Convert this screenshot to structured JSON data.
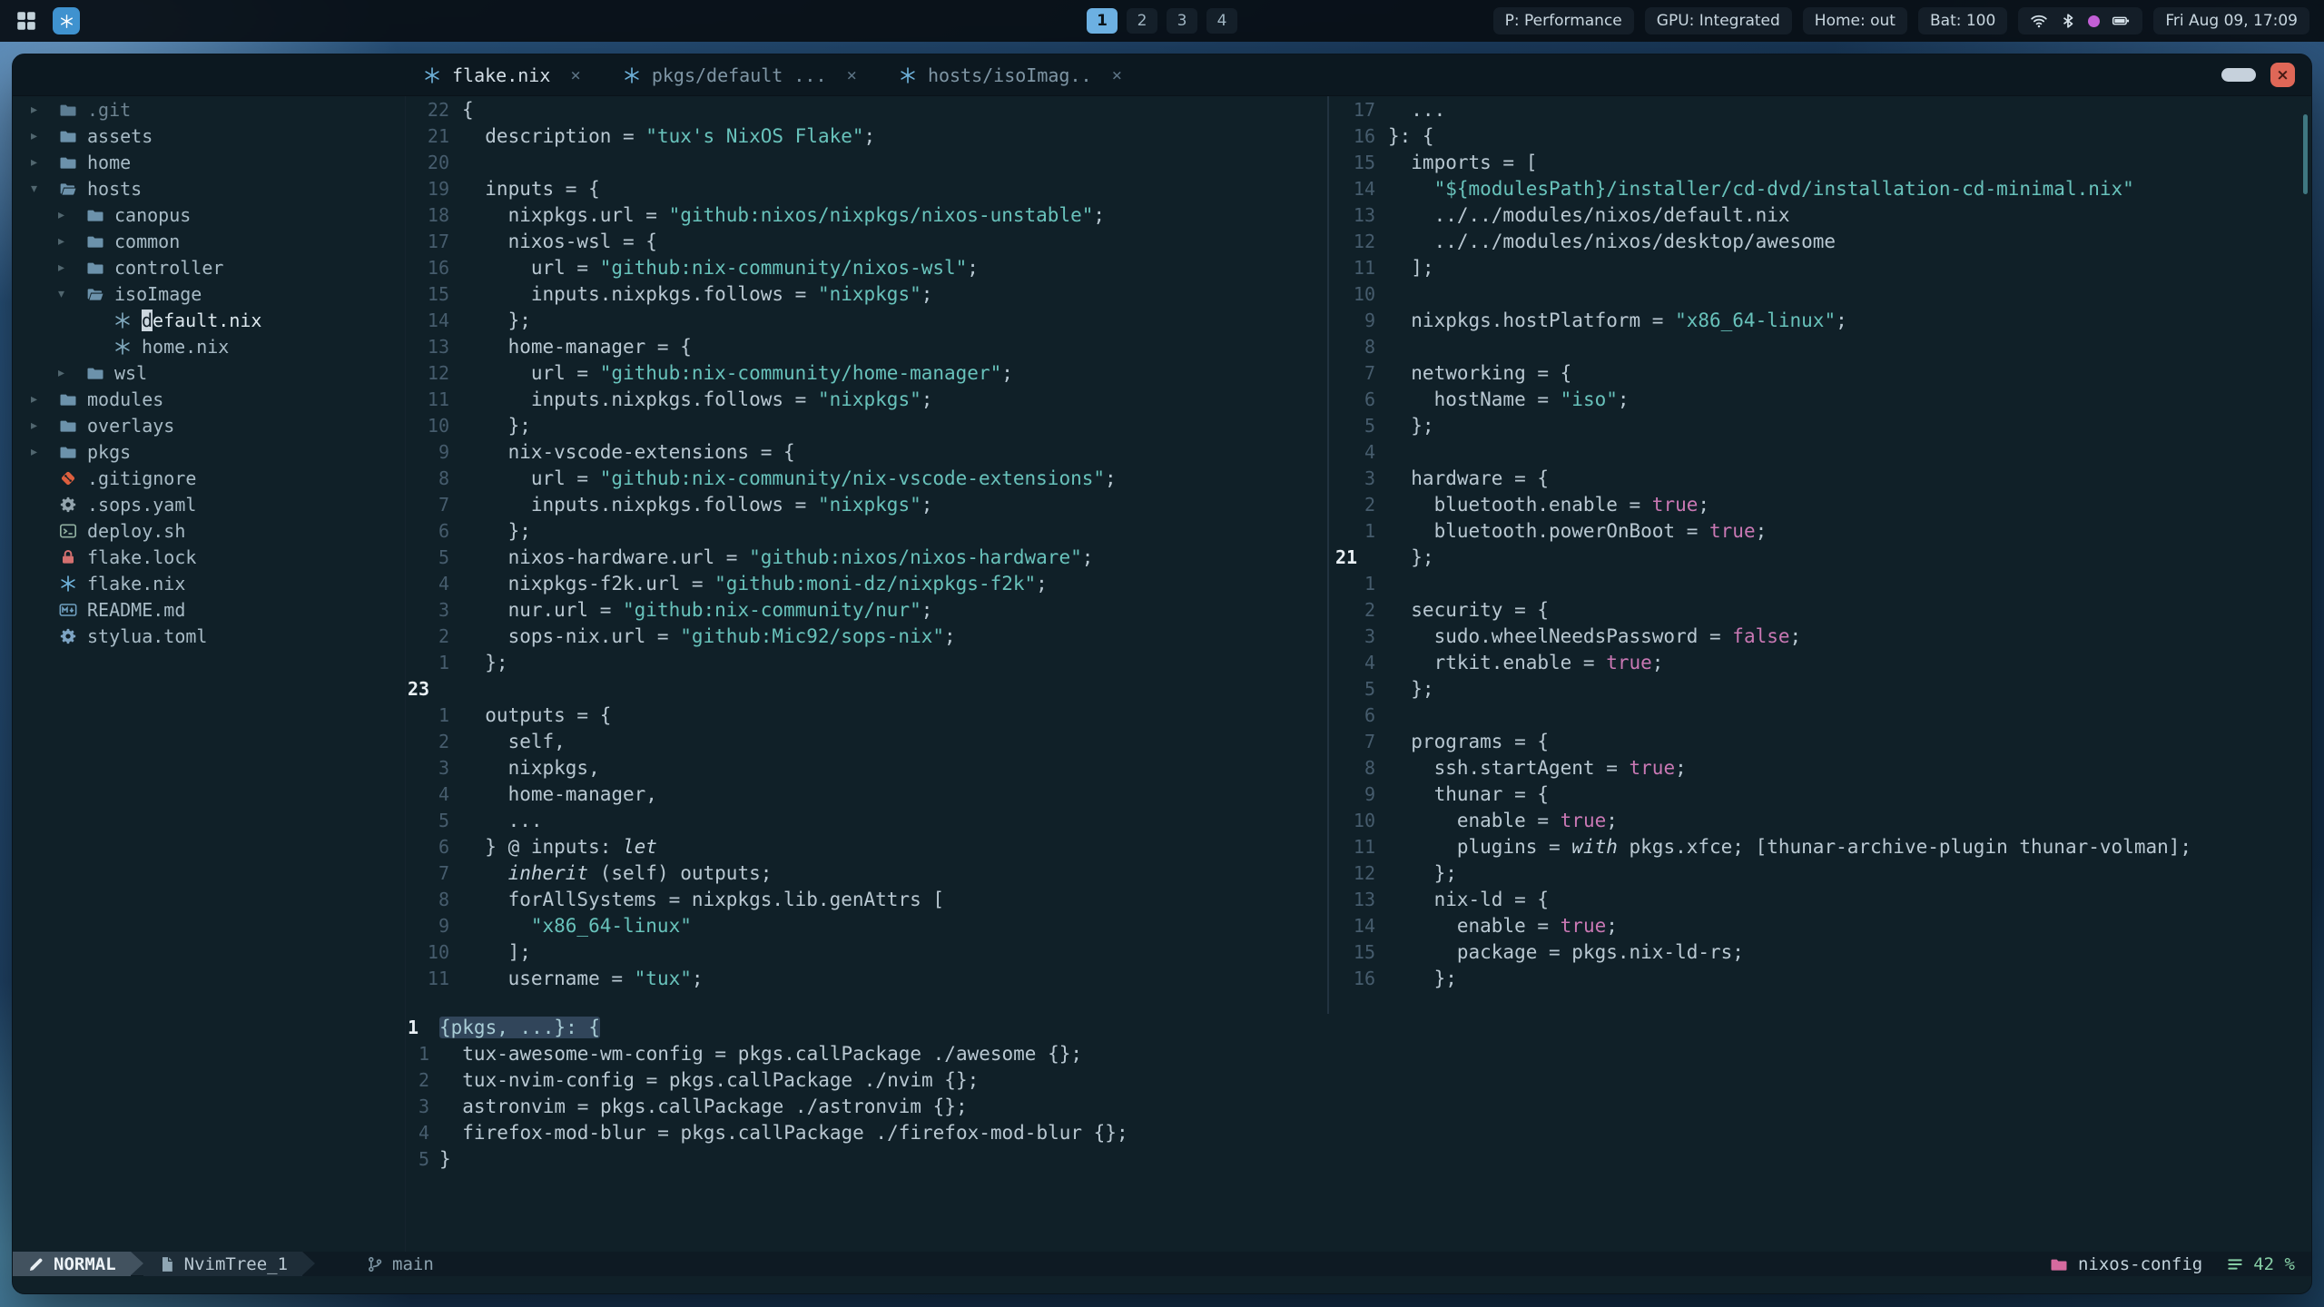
{
  "topbar": {
    "workspaces": {
      "items": [
        "1",
        "2",
        "3",
        "4"
      ],
      "active": "1"
    },
    "status_chips": [
      {
        "id": "power-profile",
        "label": "P: Performance"
      },
      {
        "id": "gpu",
        "label": "GPU: Integrated"
      },
      {
        "id": "home",
        "label": "Home: out"
      },
      {
        "id": "battery",
        "label": "Bat: 100"
      }
    ],
    "clock": "Fri Aug 09, 17:09"
  },
  "window": {
    "tabs": [
      {
        "label": "flake.nix",
        "icon": "nix",
        "active": true
      },
      {
        "label": "pkgs/default ...",
        "icon": "nix",
        "active": false
      },
      {
        "label": "hosts/isoImag..",
        "icon": "nix",
        "active": false
      }
    ],
    "close_glyph": "×",
    "controls": {
      "close": "×"
    }
  },
  "tree": {
    "items": [
      {
        "label": ".git",
        "icon": "folder",
        "chevron": "closed",
        "depth": 0,
        "dim": true,
        "iconColor": "#5c7d93"
      },
      {
        "label": "assets",
        "icon": "folder",
        "chevron": "closed",
        "depth": 0,
        "iconColor": "#6c92ab"
      },
      {
        "label": "home",
        "icon": "folder",
        "chevron": "closed",
        "depth": 0,
        "iconColor": "#6c92ab"
      },
      {
        "label": "hosts",
        "icon": "folder-open",
        "chevron": "open",
        "depth": 0,
        "iconColor": "#6c92ab"
      },
      {
        "label": "canopus",
        "icon": "folder",
        "chevron": "closed",
        "depth": 1,
        "iconColor": "#6c92ab"
      },
      {
        "label": "common",
        "icon": "folder",
        "chevron": "closed",
        "depth": 1,
        "iconColor": "#6c92ab"
      },
      {
        "label": "controller",
        "icon": "folder",
        "chevron": "closed",
        "depth": 1,
        "iconColor": "#6c92ab"
      },
      {
        "label": "isoImage",
        "icon": "folder-open",
        "chevron": "open",
        "depth": 1,
        "iconColor": "#6c92ab"
      },
      {
        "label": "default.nix",
        "icon": "nix",
        "depth": 2,
        "cursor": true,
        "iconColor": "#7fa8bd"
      },
      {
        "label": "home.nix",
        "icon": "nix",
        "depth": 2,
        "iconColor": "#7fa8bd"
      },
      {
        "label": "wsl",
        "icon": "folder",
        "chevron": "closed",
        "depth": 1,
        "iconColor": "#6c92ab"
      },
      {
        "label": "modules",
        "icon": "folder",
        "chevron": "closed",
        "depth": 0,
        "iconColor": "#6c92ab"
      },
      {
        "label": "overlays",
        "icon": "folder",
        "chevron": "closed",
        "depth": 0,
        "iconColor": "#6c92ab"
      },
      {
        "label": "pkgs",
        "icon": "folder",
        "chevron": "closed",
        "depth": 0,
        "iconColor": "#6c92ab"
      },
      {
        "label": ".gitignore",
        "icon": "git",
        "depth": 0,
        "iconColor": "#dd5f3e"
      },
      {
        "label": ".sops.yaml",
        "icon": "gear",
        "depth": 0,
        "iconColor": "#93a4ad"
      },
      {
        "label": "deploy.sh",
        "icon": "terminal",
        "depth": 0,
        "iconColor": "#8fae9f"
      },
      {
        "label": "flake.lock",
        "icon": "lock",
        "depth": 0,
        "iconColor": "#d4706f"
      },
      {
        "label": "flake.nix",
        "icon": "nix",
        "depth": 0,
        "iconColor": "#6fb3dc"
      },
      {
        "label": "README.md",
        "icon": "markdown",
        "depth": 0,
        "iconColor": "#6f9fc0"
      },
      {
        "label": "stylua.toml",
        "icon": "gear",
        "depth": 0,
        "iconColor": "#7da4c4"
      }
    ]
  },
  "editors": {
    "flake": {
      "lines": [
        {
          "n": "22",
          "t": "{"
        },
        {
          "n": "21",
          "t": "  description = \"tux's NixOS Flake\";"
        },
        {
          "n": "20",
          "t": ""
        },
        {
          "n": "19",
          "t": "  inputs = {"
        },
        {
          "n": "18",
          "t": "    nixpkgs.url = \"github:nixos/nixpkgs/nixos-unstable\";"
        },
        {
          "n": "17",
          "t": "    nixos-wsl = {"
        },
        {
          "n": "16",
          "t": "      url = \"github:nix-community/nixos-wsl\";"
        },
        {
          "n": "15",
          "t": "      inputs.nixpkgs.follows = \"nixpkgs\";"
        },
        {
          "n": "14",
          "t": "    };"
        },
        {
          "n": "13",
          "t": "    home-manager = {"
        },
        {
          "n": "12",
          "t": "      url = \"github:nix-community/home-manager\";"
        },
        {
          "n": "11",
          "t": "      inputs.nixpkgs.follows = \"nixpkgs\";"
        },
        {
          "n": "10",
          "t": "    };"
        },
        {
          "n": "9",
          "t": "    nix-vscode-extensions = {"
        },
        {
          "n": "8",
          "t": "      url = \"github:nix-community/nix-vscode-extensions\";"
        },
        {
          "n": "7",
          "t": "      inputs.nixpkgs.follows = \"nixpkgs\";"
        },
        {
          "n": "6",
          "t": "    };"
        },
        {
          "n": "5",
          "t": "    nixos-hardware.url = \"github:nixos/nixos-hardware\";"
        },
        {
          "n": "4",
          "t": "    nixpkgs-f2k.url = \"github:moni-dz/nixpkgs-f2k\";"
        },
        {
          "n": "3",
          "t": "    nur.url = \"github:nix-community/nur\";"
        },
        {
          "n": "2",
          "t": "    sops-nix.url = \"github:Mic92/sops-nix\";"
        },
        {
          "n": "1",
          "t": "  };"
        },
        {
          "n": "23",
          "t": "",
          "cur": true
        },
        {
          "n": "1",
          "t": "  outputs = {"
        },
        {
          "n": "2",
          "t": "    self,"
        },
        {
          "n": "3",
          "t": "    nixpkgs,"
        },
        {
          "n": "4",
          "t": "    home-manager,"
        },
        {
          "n": "5",
          "t": "    ..."
        },
        {
          "n": "6",
          "t": "  } @ inputs: let"
        },
        {
          "n": "7",
          "t": "    inherit (self) outputs;"
        },
        {
          "n": "8",
          "t": "    forAllSystems = nixpkgs.lib.genAttrs ["
        },
        {
          "n": "9",
          "t": "      \"x86_64-linux\""
        },
        {
          "n": "10",
          "t": "    ];"
        },
        {
          "n": "11",
          "t": "    username = \"tux\";"
        }
      ]
    },
    "iso": {
      "lines": [
        {
          "n": "17",
          "t": "  ..."
        },
        {
          "n": "16",
          "t": "}: {"
        },
        {
          "n": "15",
          "t": "  imports = ["
        },
        {
          "n": "14",
          "t": "    \"${modulesPath}/installer/cd-dvd/installation-cd-minimal.nix\""
        },
        {
          "n": "13",
          "t": "    ../../modules/nixos/default.nix"
        },
        {
          "n": "12",
          "t": "    ../../modules/nixos/desktop/awesome"
        },
        {
          "n": "11",
          "t": "  ];"
        },
        {
          "n": "10",
          "t": ""
        },
        {
          "n": "9",
          "t": "  nixpkgs.hostPlatform = \"x86_64-linux\";"
        },
        {
          "n": "8",
          "t": ""
        },
        {
          "n": "7",
          "t": "  networking = {"
        },
        {
          "n": "6",
          "t": "    hostName = \"iso\";"
        },
        {
          "n": "5",
          "t": "  };"
        },
        {
          "n": "4",
          "t": ""
        },
        {
          "n": "3",
          "t": "  hardware = {"
        },
        {
          "n": "2",
          "t": "    bluetooth.enable = true;"
        },
        {
          "n": "1",
          "t": "    bluetooth.powerOnBoot = true;"
        },
        {
          "n": "21",
          "t": "  };",
          "cur": true
        },
        {
          "n": "1",
          "t": ""
        },
        {
          "n": "2",
          "t": "  security = {"
        },
        {
          "n": "3",
          "t": "    sudo.wheelNeedsPassword = false;"
        },
        {
          "n": "4",
          "t": "    rtkit.enable = true;"
        },
        {
          "n": "5",
          "t": "  };"
        },
        {
          "n": "6",
          "t": ""
        },
        {
          "n": "7",
          "t": "  programs = {"
        },
        {
          "n": "8",
          "t": "    ssh.startAgent = true;"
        },
        {
          "n": "9",
          "t": "    thunar = {"
        },
        {
          "n": "10",
          "t": "      enable = true;"
        },
        {
          "n": "11",
          "t": "      plugins = with pkgs.xfce; [thunar-archive-plugin thunar-volman];"
        },
        {
          "n": "12",
          "t": "    };"
        },
        {
          "n": "13",
          "t": "    nix-ld = {"
        },
        {
          "n": "14",
          "t": "      enable = true;"
        },
        {
          "n": "15",
          "t": "      package = pkgs.nix-ld-rs;"
        },
        {
          "n": "16",
          "t": "    };"
        }
      ]
    },
    "pkgs": {
      "lines": [
        {
          "n": "1",
          "t": "{pkgs, ...}: {",
          "cur": true,
          "hl": true
        },
        {
          "n": "1",
          "t": "  tux-awesome-wm-config = pkgs.callPackage ./awesome {};"
        },
        {
          "n": "2",
          "t": "  tux-nvim-config = pkgs.callPackage ./nvim {};"
        },
        {
          "n": "3",
          "t": "  astronvim = pkgs.callPackage ./astronvim {};"
        },
        {
          "n": "4",
          "t": "  firefox-mod-blur = pkgs.callPackage ./firefox-mod-blur {};"
        },
        {
          "n": "5",
          "t": "}"
        }
      ]
    }
  },
  "statusline": {
    "mode": "NORMAL",
    "buffer": "NvimTree_1",
    "branch": "main",
    "project": "nixos-config",
    "progress": "42 %"
  },
  "colors": {
    "accent_blue": "#6cb0e2",
    "string_teal": "#68c2bb",
    "bool_pink": "#c978b4",
    "project_pink": "#d66a9f",
    "progress_green": "#87cfa6",
    "close_red": "#df6757"
  }
}
